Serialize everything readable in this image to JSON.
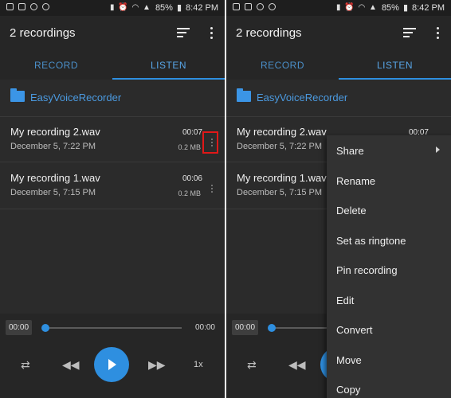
{
  "status_bar": {
    "battery": "85%",
    "time": "8:42 PM"
  },
  "app": {
    "title": "2 recordings",
    "tabs": [
      {
        "label": "RECORD"
      },
      {
        "label": "LISTEN"
      }
    ],
    "folder": "EasyVoiceRecorder"
  },
  "recordings": [
    {
      "name": "My recording 2.wav",
      "date": "December 5, 7:22 PM",
      "duration": "00:07",
      "size": "0.2 MB"
    },
    {
      "name": "My recording 1.wav",
      "date": "December 5, 7:15 PM",
      "duration": "00:06",
      "size": "0.2 MB"
    }
  ],
  "player": {
    "elapsed": "00:00",
    "total": "00:00",
    "speed": "1x",
    "progress": 0
  },
  "context_menu": {
    "items": [
      "Share",
      "Rename",
      "Delete",
      "Set as ringtone",
      "Pin recording",
      "Edit",
      "Convert",
      "Move",
      "Copy"
    ]
  },
  "colors": {
    "accent": "#2e8fe0",
    "highlight_box": "#e01818",
    "background": "#2b2b2b"
  }
}
